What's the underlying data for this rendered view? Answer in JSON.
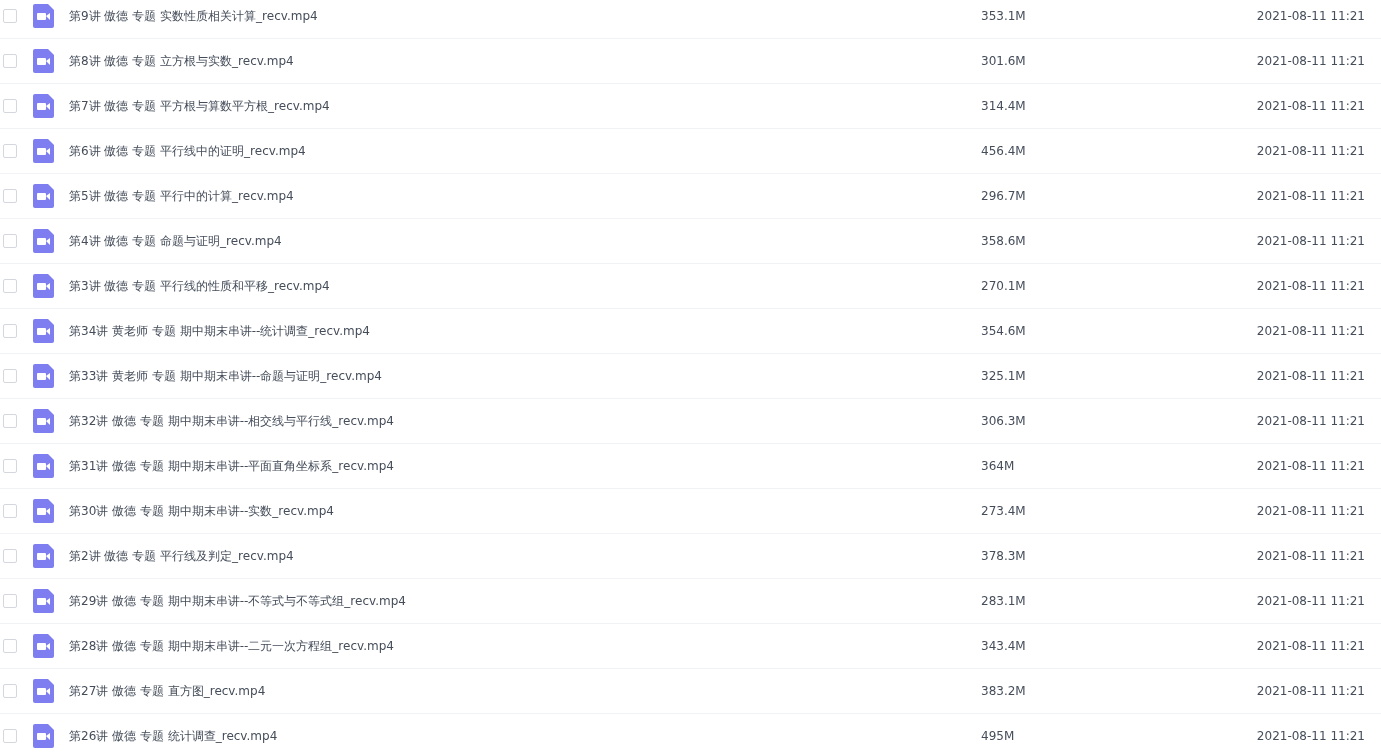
{
  "files": [
    {
      "name": "第9讲 傲德 专题 实数性质相关计算_recv.mp4",
      "size": "353.1M",
      "modified": "2021-08-11 11:21",
      "checked": false
    },
    {
      "name": "第8讲 傲德 专题 立方根与实数_recv.mp4",
      "size": "301.6M",
      "modified": "2021-08-11 11:21",
      "checked": false
    },
    {
      "name": "第7讲 傲德 专题 平方根与算数平方根_recv.mp4",
      "size": "314.4M",
      "modified": "2021-08-11 11:21",
      "checked": false
    },
    {
      "name": "第6讲 傲德 专题 平行线中的证明_recv.mp4",
      "size": "456.4M",
      "modified": "2021-08-11 11:21",
      "checked": false
    },
    {
      "name": "第5讲 傲德 专题 平行中的计算_recv.mp4",
      "size": "296.7M",
      "modified": "2021-08-11 11:21",
      "checked": false
    },
    {
      "name": "第4讲 傲德 专题 命题与证明_recv.mp4",
      "size": "358.6M",
      "modified": "2021-08-11 11:21",
      "checked": false
    },
    {
      "name": "第3讲 傲德 专题 平行线的性质和平移_recv.mp4",
      "size": "270.1M",
      "modified": "2021-08-11 11:21",
      "checked": false
    },
    {
      "name": "第34讲 黄老师 专题 期中期末串讲--统计调查_recv.mp4",
      "size": "354.6M",
      "modified": "2021-08-11 11:21",
      "checked": false
    },
    {
      "name": "第33讲 黄老师 专题 期中期末串讲--命题与证明_recv.mp4",
      "size": "325.1M",
      "modified": "2021-08-11 11:21",
      "checked": false
    },
    {
      "name": "第32讲 傲德 专题 期中期末串讲--相交线与平行线_recv.mp4",
      "size": "306.3M",
      "modified": "2021-08-11 11:21",
      "checked": false
    },
    {
      "name": "第31讲 傲德 专题 期中期末串讲--平面直角坐标系_recv.mp4",
      "size": "364M",
      "modified": "2021-08-11 11:21",
      "checked": false
    },
    {
      "name": "第30讲 傲德 专题 期中期末串讲--实数_recv.mp4",
      "size": "273.4M",
      "modified": "2021-08-11 11:21",
      "checked": false
    },
    {
      "name": "第2讲 傲德 专题 平行线及判定_recv.mp4",
      "size": "378.3M",
      "modified": "2021-08-11 11:21",
      "checked": false
    },
    {
      "name": "第29讲 傲德 专题 期中期末串讲--不等式与不等式组_recv.mp4",
      "size": "283.1M",
      "modified": "2021-08-11 11:21",
      "checked": false
    },
    {
      "name": "第28讲 傲德 专题 期中期末串讲--二元一次方程组_recv.mp4",
      "size": "343.4M",
      "modified": "2021-08-11 11:21",
      "checked": false
    },
    {
      "name": "第27讲 傲德 专题 直方图_recv.mp4",
      "size": "383.2M",
      "modified": "2021-08-11 11:21",
      "checked": false
    },
    {
      "name": "第26讲 傲德 专题 统计调查_recv.mp4",
      "size": "495M",
      "modified": "2021-08-11 11:21",
      "checked": false
    }
  ]
}
